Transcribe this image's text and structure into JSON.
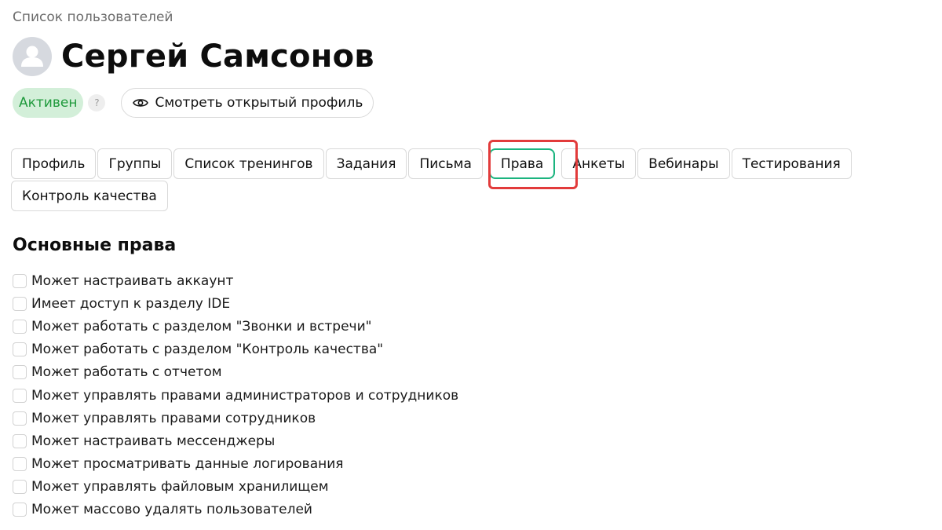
{
  "breadcrumb": {
    "label": "Список пользователей"
  },
  "user": {
    "avatar_icon": "user-avatar-icon",
    "name": "Сергей Самсонов",
    "status": "Активен",
    "status_help": "?",
    "view_profile_label": "Смотреть открытый профиль",
    "view_profile_icon": "eye-icon"
  },
  "colors": {
    "status_bg": "#d3efd9",
    "status_text": "#1f9a3c",
    "active_tab_border": "#1bb47f",
    "highlight": "#e23b3b"
  },
  "tabs": [
    {
      "label": "Профиль",
      "active": false
    },
    {
      "label": "Группы",
      "active": false
    },
    {
      "label": "Список тренингов",
      "active": false
    },
    {
      "label": "Задания",
      "active": false
    },
    {
      "label": "Письма",
      "active": false
    },
    {
      "label": "Права",
      "active": true
    },
    {
      "label": "Анкеты",
      "active": false
    },
    {
      "label": "Вебинары",
      "active": false
    },
    {
      "label": "Тестирования",
      "active": false
    },
    {
      "label": "Контроль качества",
      "active": false
    }
  ],
  "permissions_section": {
    "title": "Основные права",
    "items": [
      {
        "label": "Может настраивать аккаунт",
        "checked": false
      },
      {
        "label": "Имеет доступ к разделу IDE",
        "checked": false
      },
      {
        "label": "Может работать с разделом \"Звонки и встречи\"",
        "checked": false
      },
      {
        "label": "Может работать с разделом \"Контроль качества\"",
        "checked": false
      },
      {
        "label": "Может работать с отчетом",
        "checked": false
      },
      {
        "label": "Может управлять правами администраторов и сотрудников",
        "checked": false
      },
      {
        "label": "Может управлять правами сотрудников",
        "checked": false
      },
      {
        "label": "Может настраивать мессенджеры",
        "checked": false
      },
      {
        "label": "Может просматривать данные логирования",
        "checked": false
      },
      {
        "label": "Может управлять файловым хранилищем",
        "checked": false
      },
      {
        "label": "Может массово удалять пользователей",
        "checked": false
      }
    ]
  }
}
